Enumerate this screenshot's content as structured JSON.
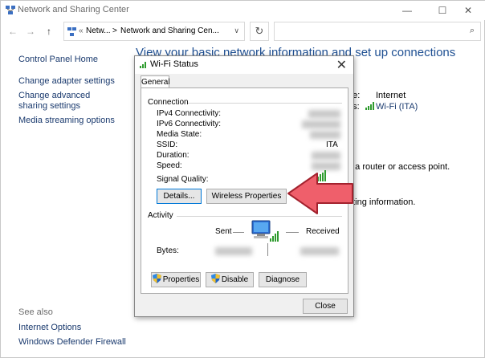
{
  "window": {
    "title": "Network and Sharing Center",
    "minimize": "—",
    "maximize": "☐",
    "close": "✕"
  },
  "nav": {
    "back": "←",
    "forward": "→",
    "up": "↑",
    "breadcrumb_root": "«",
    "breadcrumb_1": "Netw...",
    "breadcrumb_sep": ">",
    "breadcrumb_2": "Network and Sharing Cen...",
    "dropdown": "∨",
    "refresh": "↻",
    "search_placeholder": "",
    "search_icon": "⌕"
  },
  "sidebar": {
    "items": [
      "Control Panel Home",
      "Change adapter settings",
      "Change advanced sharing settings",
      "Media streaming options"
    ],
    "see_also_heading": "See also",
    "see_also": [
      "Internet Options",
      "Windows Defender Firewall"
    ]
  },
  "main": {
    "title": "View your basic network information and set up connections",
    "access_type_label_fragment": "pe:",
    "access_type_value": "Internet",
    "connections_label_fragment": "ns:",
    "connections_value": "Wi-Fi (ITA)",
    "router_fragment": "p a router or access point.",
    "troubleshoot_fragment": "oting information."
  },
  "dialog": {
    "title": "Wi-Fi Status",
    "close": "✕",
    "tab": "General",
    "connection_heading": "Connection",
    "fields": {
      "ipv4": "IPv4 Connectivity:",
      "ipv6": "IPv6 Connectivity:",
      "media": "Media State:",
      "ssid": "SSID:",
      "ssid_value": "ITA",
      "duration": "Duration:",
      "speed": "Speed:",
      "signal": "Signal Quality:"
    },
    "details_button": "Details...",
    "wireless_button": "Wireless Properties",
    "activity_heading": "Activity",
    "sent": "Sent",
    "received": "Received",
    "bytes": "Bytes:",
    "properties_button": "Properties",
    "disable_button": "Disable",
    "diagnose_button": "Diagnose",
    "close_button": "Close"
  },
  "colors": {
    "link": "#1a3a6e",
    "title_blue": "#1e4f92",
    "arrow_fill": "#ef5f6b",
    "arrow_stroke": "#a3222e",
    "signal_green": "#2e9b2e"
  }
}
